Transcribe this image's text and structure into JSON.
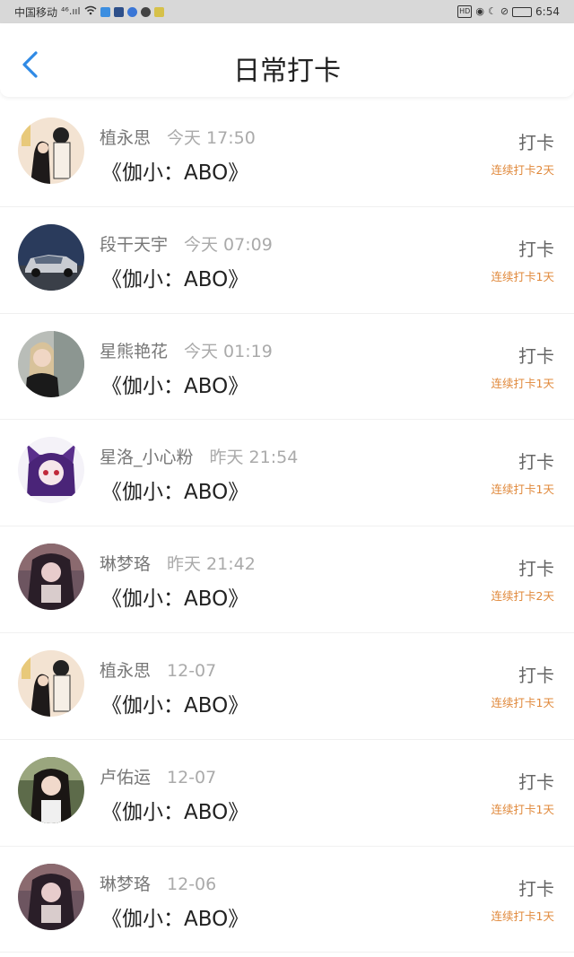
{
  "status_bar": {
    "carrier": "中国移动",
    "signal": "⁴⁶.ııl",
    "time": "6:54",
    "battery_label": "HD"
  },
  "nav": {
    "title": "日常打卡",
    "back_icon": "chevron-left-icon"
  },
  "colors": {
    "accent": "#2f8ae5",
    "streak": "#e0883a"
  },
  "checkins": [
    {
      "user": "植永思",
      "time": "今天 17:50",
      "book": "《伽小：ABO》",
      "action": "打卡",
      "streak": "连续打卡2天",
      "avatar": "couple-drawing"
    },
    {
      "user": "段干天宇",
      "time": "今天 07:09",
      "book": "《伽小：ABO》",
      "action": "打卡",
      "streak": "连续打卡1天",
      "avatar": "car"
    },
    {
      "user": "星熊艳花",
      "time": "今天 01:19",
      "book": "《伽小：ABO》",
      "action": "打卡",
      "streak": "连续打卡1天",
      "avatar": "woman-portrait"
    },
    {
      "user": "星洛_小心粉",
      "time": "昨天 21:54",
      "book": "《伽小：ABO》",
      "action": "打卡",
      "streak": "连续打卡1天",
      "avatar": "anime-purple"
    },
    {
      "user": "琳梦珞",
      "time": "昨天 21:42",
      "book": "《伽小：ABO》",
      "action": "打卡",
      "streak": "连续打卡2天",
      "avatar": "anime-dark"
    },
    {
      "user": "植永思",
      "time": "12-07",
      "book": "《伽小：ABO》",
      "action": "打卡",
      "streak": "连续打卡1天",
      "avatar": "couple-drawing"
    },
    {
      "user": "卢佑运",
      "time": "12-07",
      "book": "《伽小：ABO》",
      "action": "打卡",
      "streak": "连续打卡1天",
      "avatar": "girl-outdoor"
    },
    {
      "user": "琳梦珞",
      "time": "12-06",
      "book": "《伽小：ABO》",
      "action": "打卡",
      "streak": "连续打卡1天",
      "avatar": "anime-dark"
    }
  ]
}
